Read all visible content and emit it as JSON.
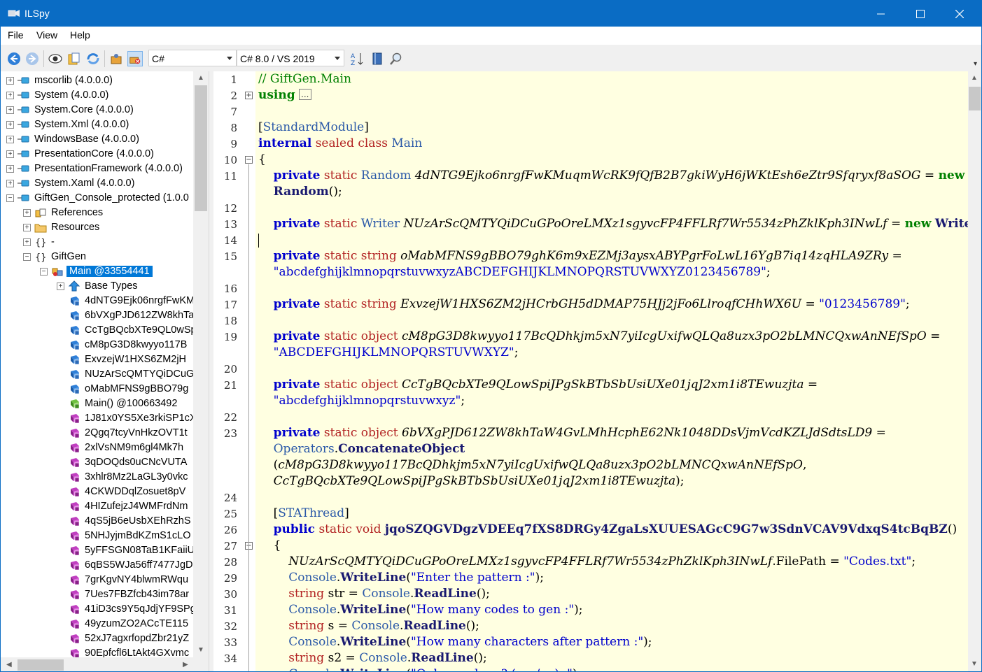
{
  "window": {
    "title": "ILSpy"
  },
  "menu": {
    "items": [
      "File",
      "View",
      "Help"
    ]
  },
  "toolbar": {
    "language": "C#",
    "version": "C# 8.0 / VS 2019",
    "icons": [
      "back-icon",
      "forward-icon",
      "view-icon",
      "open-file-icon",
      "refresh-icon",
      "gac-icon",
      "manage-assemblies-icon",
      "sort-icon",
      "book-icon",
      "search-icon"
    ]
  },
  "tree": {
    "rows": [
      {
        "label": "mscorlib (4.0.0.0)",
        "indent": 0,
        "expander": "+",
        "icon": "assembly-icon"
      },
      {
        "label": "System (4.0.0.0)",
        "indent": 0,
        "expander": "+",
        "icon": "assembly-icon"
      },
      {
        "label": "System.Core (4.0.0.0)",
        "indent": 0,
        "expander": "+",
        "icon": "assembly-icon"
      },
      {
        "label": "System.Xml (4.0.0.0)",
        "indent": 0,
        "expander": "+",
        "icon": "assembly-icon"
      },
      {
        "label": "WindowsBase (4.0.0.0)",
        "indent": 0,
        "expander": "+",
        "icon": "assembly-icon"
      },
      {
        "label": "PresentationCore (4.0.0.0)",
        "indent": 0,
        "expander": "+",
        "icon": "assembly-icon"
      },
      {
        "label": "PresentationFramework (4.0.0.0)",
        "indent": 0,
        "expander": "+",
        "icon": "assembly-icon"
      },
      {
        "label": "System.Xaml (4.0.0.0)",
        "indent": 0,
        "expander": "+",
        "icon": "assembly-icon"
      },
      {
        "label": "GiftGen_Console_protected (1.0.0",
        "indent": 0,
        "expander": "−",
        "icon": "assembly-icon"
      },
      {
        "label": "References",
        "indent": 1,
        "expander": "+",
        "icon": "references-icon"
      },
      {
        "label": "Resources",
        "indent": 1,
        "expander": "+",
        "icon": "folder-icon"
      },
      {
        "label": "-",
        "indent": 1,
        "expander": "+",
        "icon": "namespace-icon"
      },
      {
        "label": "GiftGen",
        "indent": 1,
        "expander": "−",
        "icon": "namespace-icon"
      },
      {
        "label": "Main @33554441",
        "indent": 2,
        "expander": "−",
        "icon": "class-icon",
        "selected": true
      },
      {
        "label": "Base Types",
        "indent": 3,
        "expander": "+",
        "icon": "base-types-icon"
      },
      {
        "label": "4dNTG9Ejk06nrgfFwKM",
        "indent": 3,
        "expander": "",
        "icon": "field-icon"
      },
      {
        "label": "6bVXgPJD612ZW8khTa",
        "indent": 3,
        "expander": "",
        "icon": "field-icon"
      },
      {
        "label": "CcTgBQcbXTe9QL0wSp",
        "indent": 3,
        "expander": "",
        "icon": "field-icon"
      },
      {
        "label": "cM8pG3D8kwyyo117B",
        "indent": 3,
        "expander": "",
        "icon": "field-icon"
      },
      {
        "label": "ExvzejW1HXS6ZM2jH",
        "indent": 3,
        "expander": "",
        "icon": "field-icon"
      },
      {
        "label": "NUzArScQMTYQiDCuG",
        "indent": 3,
        "expander": "",
        "icon": "field-icon"
      },
      {
        "label": "oMabMFNS9gBBO79g",
        "indent": 3,
        "expander": "",
        "icon": "field-icon"
      },
      {
        "label": "Main() @100663492",
        "indent": 3,
        "expander": "",
        "icon": "constructor-icon"
      },
      {
        "label": "1J81x0YS5Xe3rkiSP1cX",
        "indent": 3,
        "expander": "",
        "icon": "method-icon"
      },
      {
        "label": "2Qgq7tcyVnHkzOVT1t",
        "indent": 3,
        "expander": "",
        "icon": "method-icon"
      },
      {
        "label": "2xlVsNM9m6gl4Mk7h",
        "indent": 3,
        "expander": "",
        "icon": "method-icon"
      },
      {
        "label": "3qDOQds0uCNcVUTA",
        "indent": 3,
        "expander": "",
        "icon": "method-icon"
      },
      {
        "label": "3xhlr8Mz2LaGL3y0vkc",
        "indent": 3,
        "expander": "",
        "icon": "method-icon"
      },
      {
        "label": "4CKWDDqlZosuet8pV",
        "indent": 3,
        "expander": "",
        "icon": "method-icon"
      },
      {
        "label": "4HIZufejzJ4WMFrdNm",
        "indent": 3,
        "expander": "",
        "icon": "method-icon"
      },
      {
        "label": "4qS5jB6eUsbXEhRzhS",
        "indent": 3,
        "expander": "",
        "icon": "method-icon"
      },
      {
        "label": "5NHJyjmBdKZmS1cLO",
        "indent": 3,
        "expander": "",
        "icon": "method-icon"
      },
      {
        "label": "5yFFSGN08TaB1KFaiiU",
        "indent": 3,
        "expander": "",
        "icon": "method-icon"
      },
      {
        "label": "6qBS5WJa56ff7477JgD",
        "indent": 3,
        "expander": "",
        "icon": "method-icon"
      },
      {
        "label": "7grKgvNY4blwmRWqu",
        "indent": 3,
        "expander": "",
        "icon": "method-icon"
      },
      {
        "label": "7Ues7FBZfcb43im78ar",
        "indent": 3,
        "expander": "",
        "icon": "method-icon"
      },
      {
        "label": "41iD3cs9Y5qJdjYF9SPg",
        "indent": 3,
        "expander": "",
        "icon": "method-icon"
      },
      {
        "label": "49yzumZO2ACcTE115",
        "indent": 3,
        "expander": "",
        "icon": "method-icon"
      },
      {
        "label": "52xJ7agxrfopdZbr21yZ",
        "indent": 3,
        "expander": "",
        "icon": "method-icon"
      },
      {
        "label": "90Epfcfl6LtAkt4GXvmc",
        "indent": 3,
        "expander": "",
        "icon": "method-icon"
      }
    ]
  },
  "editor": {
    "lines": [
      {
        "n": "1",
        "html": [
          [
            "c-comment",
            "// GiftGen.Main"
          ]
        ]
      },
      {
        "n": "2",
        "html": [
          [
            "c-kw2",
            "using"
          ],
          [
            "",
            " "
          ],
          [
            "box",
            "..."
          ]
        ],
        "fold": "+"
      },
      {
        "n": "7",
        "html": []
      },
      {
        "n": "8",
        "html": [
          [
            "",
            "["
          ],
          [
            "c-type",
            "StandardModule"
          ],
          [
            "",
            "]"
          ]
        ]
      },
      {
        "n": "9",
        "html": [
          [
            "c-kw",
            "internal"
          ],
          [
            "",
            " "
          ],
          [
            "c-mod",
            "sealed class"
          ],
          [
            "",
            " "
          ],
          [
            "c-type",
            "Main"
          ]
        ]
      },
      {
        "n": "10",
        "html": [
          [
            "",
            "{"
          ]
        ],
        "fold": "−"
      },
      {
        "n": "11",
        "html": [
          [
            "",
            "    "
          ],
          [
            "c-kw",
            "private"
          ],
          [
            "",
            " "
          ],
          [
            "c-mod",
            "static"
          ],
          [
            "",
            " "
          ],
          [
            "c-type",
            "Random"
          ],
          [
            "",
            " "
          ],
          [
            "c-mem",
            "4dNTG9Ejko6nrgfFwKMuqmWcRK9fQfB2B7gkiWyH6jWKtEsh6eZtr9Sfqryxf8aSOG"
          ],
          [
            "",
            " = "
          ],
          [
            "c-kw2",
            "new"
          ]
        ]
      },
      {
        "n": "",
        "html": [
          [
            "",
            "    "
          ],
          [
            "c-call",
            "Random"
          ],
          [
            "",
            "();"
          ]
        ]
      },
      {
        "n": "12",
        "html": []
      },
      {
        "n": "13",
        "html": [
          [
            "",
            "    "
          ],
          [
            "c-kw",
            "private"
          ],
          [
            "",
            " "
          ],
          [
            "c-mod",
            "static"
          ],
          [
            "",
            " "
          ],
          [
            "c-type",
            "Writer"
          ],
          [
            "",
            " "
          ],
          [
            "c-mem",
            "NUzArScQMTYQiDCuGPoOreLMXz1sgyvcFP4FFLRf7Wr5534zPhZklKph3INwLf"
          ],
          [
            "",
            " = "
          ],
          [
            "c-kw2",
            "new"
          ],
          [
            "",
            " "
          ],
          [
            "c-call",
            "Writer"
          ],
          [
            "",
            "();"
          ]
        ]
      },
      {
        "n": "14",
        "html": []
      },
      {
        "n": "15",
        "html": [
          [
            "",
            "    "
          ],
          [
            "c-kw",
            "private"
          ],
          [
            "",
            " "
          ],
          [
            "c-mod",
            "static string"
          ],
          [
            "",
            " "
          ],
          [
            "c-mem",
            "oMabMFNS9gBBO79ghK6m9xEZMj3aysxABYPgrFoLwL16YgB7iq14zqHLA9ZRy"
          ],
          [
            "",
            " ="
          ]
        ]
      },
      {
        "n": "",
        "html": [
          [
            "",
            "    "
          ],
          [
            "c-str",
            "\"abcdefghijklmnopqrstuvwxyzABCDEFGHIJKLMNOPQRSTUVWXYZ0123456789\""
          ],
          [
            "",
            ";"
          ]
        ]
      },
      {
        "n": "16",
        "html": []
      },
      {
        "n": "17",
        "html": [
          [
            "",
            "    "
          ],
          [
            "c-kw",
            "private"
          ],
          [
            "",
            " "
          ],
          [
            "c-mod",
            "static string"
          ],
          [
            "",
            " "
          ],
          [
            "c-mem",
            "ExvzejW1HXS6ZM2jHCrbGH5dDMAP75HJj2jFo6LlroqfCHhWX6U"
          ],
          [
            "",
            " = "
          ],
          [
            "c-str",
            "\"0123456789\""
          ],
          [
            "",
            ";"
          ]
        ]
      },
      {
        "n": "18",
        "html": []
      },
      {
        "n": "19",
        "html": [
          [
            "",
            "    "
          ],
          [
            "c-kw",
            "private"
          ],
          [
            "",
            " "
          ],
          [
            "c-mod",
            "static object"
          ],
          [
            "",
            " "
          ],
          [
            "c-mem",
            "cM8pG3D8kwyyo117BcQDhkjm5xN7yiIcgUxifwQLQa8uzx3pO2bLMNCQxwAnNEfSpO"
          ],
          [
            "",
            " ="
          ]
        ]
      },
      {
        "n": "",
        "html": [
          [
            "",
            "    "
          ],
          [
            "c-str",
            "\"ABCDEFGHIJKLMNOPQRSTUVWXYZ\""
          ],
          [
            "",
            ";"
          ]
        ]
      },
      {
        "n": "20",
        "html": []
      },
      {
        "n": "21",
        "html": [
          [
            "",
            "    "
          ],
          [
            "c-kw",
            "private"
          ],
          [
            "",
            " "
          ],
          [
            "c-mod",
            "static object"
          ],
          [
            "",
            " "
          ],
          [
            "c-mem",
            "CcTgBQcbXTe9QLowSpiJPgSkBTbSbUsiUXe01jqJ2xm1i8TEwuzjta"
          ],
          [
            "",
            " ="
          ]
        ]
      },
      {
        "n": "",
        "html": [
          [
            "",
            "    "
          ],
          [
            "c-str",
            "\"abcdefghijklmnopqrstuvwxyz\""
          ],
          [
            "",
            ";"
          ]
        ]
      },
      {
        "n": "22",
        "html": []
      },
      {
        "n": "23",
        "html": [
          [
            "",
            "    "
          ],
          [
            "c-kw",
            "private"
          ],
          [
            "",
            " "
          ],
          [
            "c-mod",
            "static object"
          ],
          [
            "",
            " "
          ],
          [
            "c-mem",
            "6bVXgPJD612ZW8khTaW4GvLMhHcphE62Nk1048DDsVjmVcdKZLJdSdtsLD9"
          ],
          [
            "",
            " ="
          ]
        ]
      },
      {
        "n": "",
        "html": [
          [
            "",
            "    "
          ],
          [
            "c-type",
            "Operators"
          ],
          [
            "",
            "."
          ],
          [
            "c-call",
            "ConcatenateObject"
          ]
        ]
      },
      {
        "n": "",
        "html": [
          [
            "",
            "    ("
          ],
          [
            "c-mem",
            "cM8pG3D8kwyyo117BcQDhkjm5xN7yiIcgUxifwQLQa8uzx3pO2bLMNCQxwAnNEfSpO"
          ],
          [
            "",
            ","
          ]
        ]
      },
      {
        "n": "",
        "html": [
          [
            "",
            "    "
          ],
          [
            "c-mem",
            "CcTgBQcbXTe9QLowSpiJPgSkBTbSbUsiUXe01jqJ2xm1i8TEwuzjta"
          ],
          [
            "",
            ");"
          ]
        ]
      },
      {
        "n": "24",
        "html": []
      },
      {
        "n": "25",
        "html": [
          [
            "",
            "    ["
          ],
          [
            "c-type",
            "STAThread"
          ],
          [
            "",
            "]"
          ]
        ]
      },
      {
        "n": "26",
        "html": [
          [
            "",
            "    "
          ],
          [
            "c-kw",
            "public"
          ],
          [
            "",
            " "
          ],
          [
            "c-mod",
            "static void"
          ],
          [
            "",
            " "
          ],
          [
            "c-call",
            "jqoSZQGVDgzVDEEq7fXS8DRGy4ZgaLsXUUESAGcC9G7w3SdnVCAV9VdxqS4tcBqBZ"
          ],
          [
            "",
            "()"
          ]
        ]
      },
      {
        "n": "27",
        "html": [
          [
            "",
            "    {"
          ]
        ],
        "fold": "−"
      },
      {
        "n": "28",
        "html": [
          [
            "",
            "        "
          ],
          [
            "c-mem",
            "NUzArScQMTYQiDCuGPoOreLMXz1sgyvcFP4FFLRf7Wr5534zPhZklKph3INwLf"
          ],
          [
            "",
            ".FilePath = "
          ],
          [
            "c-str",
            "\"Codes.txt\""
          ],
          [
            "",
            ";"
          ]
        ]
      },
      {
        "n": "29",
        "html": [
          [
            "",
            "        "
          ],
          [
            "c-type",
            "Console"
          ],
          [
            "",
            "."
          ],
          [
            "c-call",
            "WriteLine"
          ],
          [
            "",
            "("
          ],
          [
            "c-str",
            "\"Enter the pattern :\""
          ],
          [
            "",
            ");"
          ]
        ]
      },
      {
        "n": "30",
        "html": [
          [
            "",
            "        "
          ],
          [
            "c-mod",
            "string"
          ],
          [
            "",
            " str = "
          ],
          [
            "c-type",
            "Console"
          ],
          [
            "",
            "."
          ],
          [
            "c-call",
            "ReadLine"
          ],
          [
            "",
            "();"
          ]
        ]
      },
      {
        "n": "31",
        "html": [
          [
            "",
            "        "
          ],
          [
            "c-type",
            "Console"
          ],
          [
            "",
            "."
          ],
          [
            "c-call",
            "WriteLine"
          ],
          [
            "",
            "("
          ],
          [
            "c-str",
            "\"How many codes to gen :\""
          ],
          [
            "",
            ");"
          ]
        ]
      },
      {
        "n": "32",
        "html": [
          [
            "",
            "        "
          ],
          [
            "c-mod",
            "string"
          ],
          [
            "",
            " s = "
          ],
          [
            "c-type",
            "Console"
          ],
          [
            "",
            "."
          ],
          [
            "c-call",
            "ReadLine"
          ],
          [
            "",
            "();"
          ]
        ]
      },
      {
        "n": "33",
        "html": [
          [
            "",
            "        "
          ],
          [
            "c-type",
            "Console"
          ],
          [
            "",
            "."
          ],
          [
            "c-call",
            "WriteLine"
          ],
          [
            "",
            "("
          ],
          [
            "c-str",
            "\"How many characters after pattern :\""
          ],
          [
            "",
            ");"
          ]
        ]
      },
      {
        "n": "34",
        "html": [
          [
            "",
            "        "
          ],
          [
            "c-mod",
            "string"
          ],
          [
            "",
            " s2 = "
          ],
          [
            "c-type",
            "Console"
          ],
          [
            "",
            "."
          ],
          [
            "c-call",
            "ReadLine"
          ],
          [
            "",
            "();"
          ]
        ]
      },
      {
        "n": "",
        "html": [
          [
            "",
            "        "
          ],
          [
            "c-type",
            "Console"
          ],
          [
            "",
            "."
          ],
          [
            "c-call",
            "WriteLine"
          ],
          [
            "",
            "("
          ],
          [
            "c-str",
            "\"Only numbers? (yes/no) :\""
          ],
          [
            "",
            ");"
          ]
        ]
      }
    ]
  },
  "colors": {
    "titlebar": "#0a6cc4",
    "editor_bg": "#ffffe1",
    "selection": "#0078d7"
  }
}
